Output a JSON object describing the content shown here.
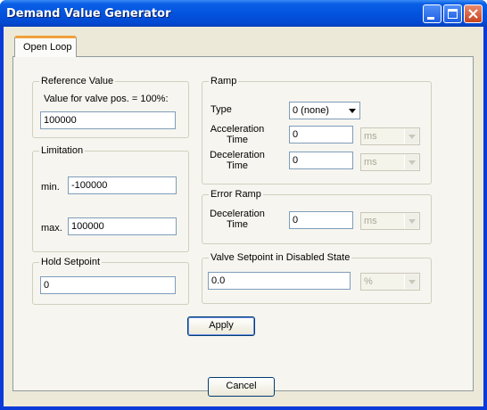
{
  "window": {
    "title": "Demand Value Generator"
  },
  "tabs": [
    {
      "label": "Open Loop"
    }
  ],
  "reference": {
    "group_label": "Reference Value",
    "caption": "Value for valve pos. = 100%:",
    "value": "100000"
  },
  "limitation": {
    "group_label": "Limitation",
    "min_label": "min.",
    "min_value": "-100000",
    "max_label": "max.",
    "max_value": "100000"
  },
  "hold": {
    "group_label": "Hold Setpoint",
    "value": "0"
  },
  "ramp": {
    "group_label": "Ramp",
    "type_label": "Type",
    "type_value": "0 (none)",
    "accel_label_1": "Acceleration",
    "accel_label_2": "Time",
    "accel_value": "0",
    "accel_unit": "ms",
    "decel_label_1": "Deceleration",
    "decel_label_2": "Time",
    "decel_value": "0",
    "decel_unit": "ms"
  },
  "error_ramp": {
    "group_label": "Error Ramp",
    "decel_label_1": "Deceleration",
    "decel_label_2": "Time",
    "decel_value": "0",
    "decel_unit": "ms"
  },
  "disabled_state": {
    "group_label": "Valve Setpoint in Disabled State",
    "value": "0.0",
    "unit": "%"
  },
  "buttons": {
    "apply": "Apply",
    "cancel": "Cancel"
  },
  "colors": {
    "titlebar": "#0354de",
    "tab_accent": "#f0a13c",
    "face": "#ece9d8"
  }
}
